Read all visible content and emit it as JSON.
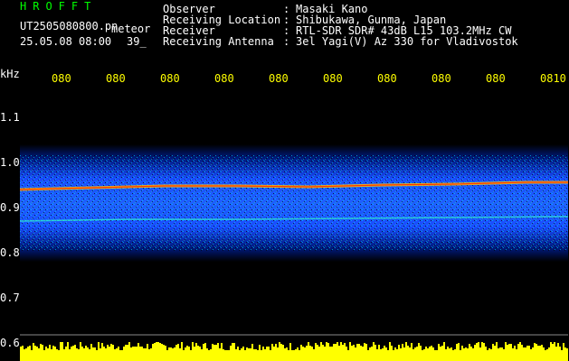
{
  "header": {
    "title": "HROFFT",
    "filename": "UT2505080800.pn",
    "subtitle": "meteor",
    "datetime": "25.05.08 08:00",
    "count": "39_"
  },
  "info": [
    {
      "label": "Observer",
      "colon": ":",
      "value": "Masaki Kano"
    },
    {
      "label": "Receiving Location",
      "colon": ":",
      "value": "Shibukawa, Gunma, Japan"
    },
    {
      "label": "Receiver",
      "colon": ":",
      "value": "RTL-SDR SDR# 43dB L15 103.2MHz CW"
    },
    {
      "label": "Receiving Antenna",
      "colon": ":",
      "value": "3el Yagi(V) Az 330 for Vladivostok"
    }
  ],
  "axes": {
    "y_unit": "kHz",
    "y_ticks": [
      "1.1",
      "1.0",
      "0.9",
      "0.8",
      "0.7",
      "0.6"
    ],
    "x_ticks": [
      "080",
      "080",
      "080",
      "080",
      "080",
      "080",
      "080",
      "080",
      "080",
      "0810"
    ]
  },
  "colors": {
    "text": "#ffffff",
    "title": "#00ff00",
    "axis_text": "#ffff00",
    "band": "#1a4cff",
    "trace": "#ff3300"
  }
}
